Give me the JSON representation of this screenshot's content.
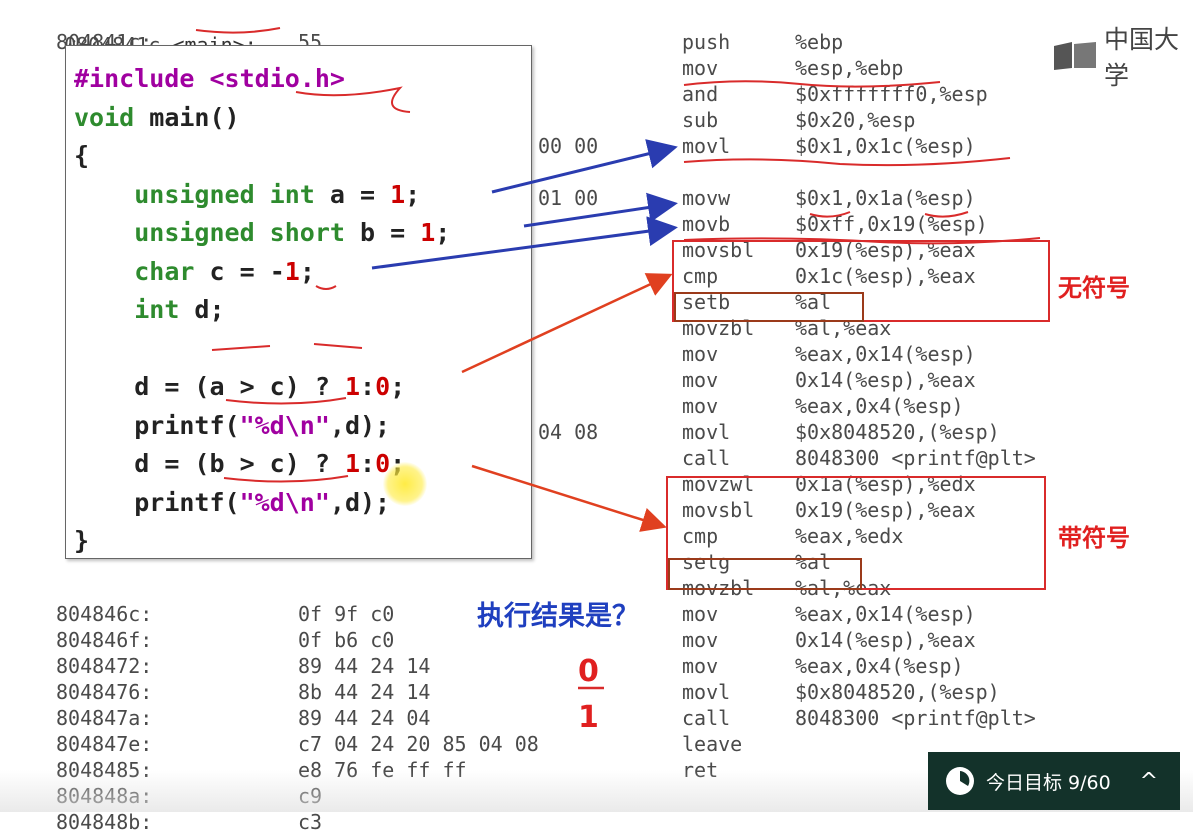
{
  "title": {
    "addr": "0804841c",
    "func": "<main>:"
  },
  "addresses": [
    "804841c:",
    "",
    "",
    "",
    "",
    "",
    "",
    "",
    "",
    "",
    "",
    "",
    "",
    "",
    "",
    "",
    "",
    "",
    "",
    "",
    "",
    "",
    "804846c:",
    "804846f:",
    "8048472:",
    "8048476:",
    "804847a:",
    "804847e:",
    "8048485:",
    "804848a:",
    "804848b:"
  ],
  "bytes": [
    "55",
    "",
    "",
    "",
    "",
    "",
    "",
    "",
    "",
    "",
    "",
    "",
    "",
    "",
    "",
    "",
    "",
    "",
    "",
    "",
    "",
    "",
    "0f 9f c0",
    "0f b6 c0",
    "89 44 24 14",
    "8b 44 24 14",
    "89 44 24 04",
    "c7 04 24 20 85 04 08",
    "e8 76 fe ff ff",
    "c9",
    "c3"
  ],
  "mid_bytes": [
    "",
    "",
    "",
    "",
    "00 00",
    "",
    "01 00",
    "",
    "",
    "",
    "",
    "",
    "",
    "",
    "",
    "04 08"
  ],
  "instructions": [
    {
      "mn": "push",
      "op": "%ebp"
    },
    {
      "mn": "mov",
      "op": "%esp,%ebp"
    },
    {
      "mn": "and",
      "op": "$0xfffffff0,%esp"
    },
    {
      "mn": "sub",
      "op": "$0x20,%esp"
    },
    {
      "mn": "movl",
      "op": "$0x1,0x1c(%esp)"
    },
    {
      "mn": "",
      "op": ""
    },
    {
      "mn": "movw",
      "op": "$0x1,0x1a(%esp)"
    },
    {
      "mn": "movb",
      "op": "$0xff,0x19(%esp)"
    },
    {
      "mn": "movsbl",
      "op": "0x19(%esp),%eax"
    },
    {
      "mn": "cmp",
      "op": "0x1c(%esp),%eax"
    },
    {
      "mn": "setb",
      "op": "%al"
    },
    {
      "mn": "movzbl",
      "op": "%al,%eax"
    },
    {
      "mn": "mov",
      "op": "%eax,0x14(%esp)"
    },
    {
      "mn": "mov",
      "op": "0x14(%esp),%eax"
    },
    {
      "mn": "mov",
      "op": "%eax,0x4(%esp)"
    },
    {
      "mn": "movl",
      "op": "$0x8048520,(%esp)"
    },
    {
      "mn": "call",
      "op": "8048300 <printf@plt>"
    },
    {
      "mn": "movzwl",
      "op": "0x1a(%esp),%edx"
    },
    {
      "mn": "movsbl",
      "op": "0x19(%esp),%eax"
    },
    {
      "mn": "cmp",
      "op": "%eax,%edx"
    },
    {
      "mn": "setg",
      "op": "%al"
    },
    {
      "mn": "movzbl",
      "op": "%al,%eax"
    },
    {
      "mn": "mov",
      "op": "%eax,0x14(%esp)"
    },
    {
      "mn": "mov",
      "op": "0x14(%esp),%eax"
    },
    {
      "mn": "mov",
      "op": "%eax,0x4(%esp)"
    },
    {
      "mn": "movl",
      "op": "$0x8048520,(%esp)"
    },
    {
      "mn": "call",
      "op": "8048300 <printf@plt>"
    },
    {
      "mn": "leave",
      "op": ""
    },
    {
      "mn": "ret",
      "op": ""
    }
  ],
  "code": {
    "l1_pp": "#include",
    "l1_hdr": "<stdio.h>",
    "l2_kw": "void",
    "l2_rest": " main()",
    "l3": "{",
    "l4_kw": "unsigned int",
    "l4_var": " a = ",
    "l4_num": "1",
    "l4_end": ";",
    "l5_kw": "unsigned short",
    "l5_var": " b = ",
    "l5_num": "1",
    "l5_end": ";",
    "l6_kw": "char",
    "l6_var": " c = -",
    "l6_num": "1",
    "l6_end": ";",
    "l7_kw": "int",
    "l7_var": " d;",
    "l8_pre": "d = (a > c) ? ",
    "l8_n1": "1",
    "l8_colon": ":",
    "l8_n2": "0",
    "l8_end": ";",
    "l9_pre": "printf(",
    "l9_str": "\"%d\\n\"",
    "l9_end": ",d);",
    "l10_pre": "d = (b > c) ? ",
    "l10_n1": "1",
    "l10_colon": ":",
    "l10_n2": "0",
    "l10_end": ";",
    "l11_pre": "printf(",
    "l11_str": "\"%d\\n\"",
    "l11_end": ",d);",
    "l12": "}"
  },
  "labels": {
    "unsigned": "无符号",
    "signed": "带符号",
    "question": "执行结果是？",
    "answer1": "0",
    "answer2": "1"
  },
  "logo": {
    "text": "中国大学"
  },
  "goal": {
    "label": "今日目标 9/60"
  },
  "colors": {
    "red": "#e02020",
    "blue": "#1f3fbf",
    "purple": "#a000a0",
    "green": "#2e8b2e",
    "goal_bg": "#13322a"
  }
}
